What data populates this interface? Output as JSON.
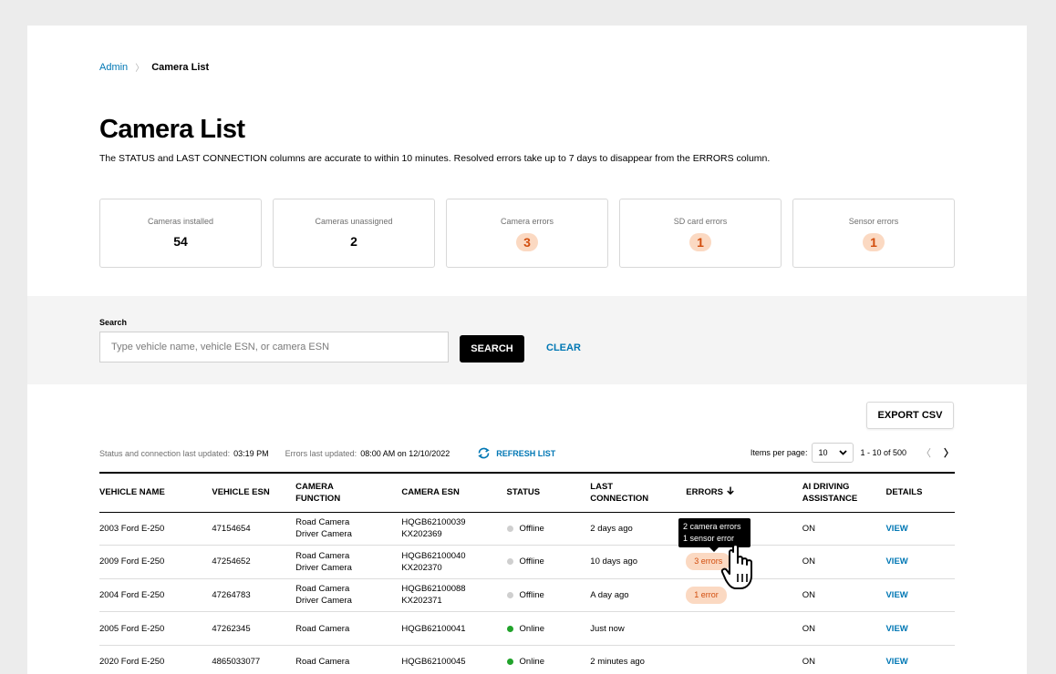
{
  "breadcrumb": {
    "parent": "Admin",
    "separator": "〉",
    "current": "Camera List"
  },
  "page": {
    "title": "Camera List",
    "description": "The STATUS and LAST CONNECTION columns are accurate to within 10 minutes. Resolved errors take up to 7 days to disappear from the ERRORS column."
  },
  "stats": [
    {
      "label": "Cameras installed",
      "value": "54",
      "style": "plain"
    },
    {
      "label": "Cameras unassigned",
      "value": "2",
      "style": "plain"
    },
    {
      "label": "Camera errors",
      "value": "3",
      "style": "badge"
    },
    {
      "label": "SD card errors",
      "value": "1",
      "style": "badge"
    },
    {
      "label": "Sensor errors",
      "value": "1",
      "style": "badge"
    }
  ],
  "search": {
    "label": "Search",
    "placeholder": "Type vehicle name, vehicle ESN, or camera ESN",
    "value": "",
    "button": "SEARCH",
    "clear": "CLEAR"
  },
  "export_label": "EXPORT CSV",
  "status_bar": {
    "status_label": "Status and connection last updated:",
    "status_time": "03:19 PM",
    "errors_label": "Errors last updated:",
    "errors_time": "08:00 AM on 12/10/2022",
    "refresh": "REFRESH LIST"
  },
  "pager": {
    "items_label": "Items per page:",
    "per_page": "10",
    "range": "1 - 10 of 500",
    "prev": "〈",
    "next": "〉"
  },
  "table": {
    "headers": {
      "vehicle_name": "VEHICLE NAME",
      "vehicle_esn": "VEHICLE ESN",
      "camera_function_1": "CAMERA",
      "camera_function_2": "FUNCTION",
      "camera_esn": "CAMERA ESN",
      "status": "STATUS",
      "last_connection_1": "LAST",
      "last_connection_2": "CONNECTION",
      "errors": "ERRORS",
      "ai_1": "AI DRIVING",
      "ai_2": "ASSISTANCE",
      "details": "DETAILS"
    },
    "rows": [
      {
        "vehicle": "2003 Ford E-250",
        "esn": "47154654",
        "function": [
          "Road Camera",
          "Driver Camera"
        ],
        "camera_esn": [
          "HQGB62100039",
          "KX202369"
        ],
        "status": "Offline",
        "last": "2 days ago",
        "errors": "",
        "ai": "ON",
        "details": "VIEW"
      },
      {
        "vehicle": "2009 Ford E-250",
        "esn": "47254652",
        "function": [
          "Road Camera",
          "Driver Camera"
        ],
        "camera_esn": [
          "HQGB62100040",
          "KX202370"
        ],
        "status": "Offline",
        "last": "10 days ago",
        "errors": "3 errors",
        "ai": "ON",
        "details": "VIEW"
      },
      {
        "vehicle": "2004 Ford E-250",
        "esn": "47264783",
        "function": [
          "Road Camera",
          "Driver Camera"
        ],
        "camera_esn": [
          "HQGB62100088",
          "KX202371"
        ],
        "status": "Offline",
        "last": "A day ago",
        "errors": "1 error",
        "ai": "ON",
        "details": "VIEW"
      },
      {
        "vehicle": "2005 Ford E-250",
        "esn": "47262345",
        "function": [
          "Road Camera"
        ],
        "camera_esn": [
          "HQGB62100041"
        ],
        "status": "Online",
        "last": "Just now",
        "errors": "",
        "ai": "ON",
        "details": "VIEW"
      },
      {
        "vehicle": "2020 Ford E-250",
        "esn": "4865033077",
        "function": [
          "Road Camera"
        ],
        "camera_esn": [
          "HQGB62100045"
        ],
        "status": "Online",
        "last": "2 minutes ago",
        "errors": "",
        "ai": "ON",
        "details": "VIEW"
      }
    ]
  },
  "tooltip": {
    "line1": "2 camera errors",
    "line2": "1 sensor error"
  },
  "icons": {
    "refresh": "refresh-icon",
    "sort": "arrow-down-icon",
    "cursor": "hand-pointer-icon",
    "dropdown": "chevron-down-icon"
  },
  "colors": {
    "accent": "#0077b4",
    "error_bg": "#fbd9c2",
    "error_text": "#d24d0d",
    "online": "#21a32b",
    "offline": "#cfcfcf"
  }
}
